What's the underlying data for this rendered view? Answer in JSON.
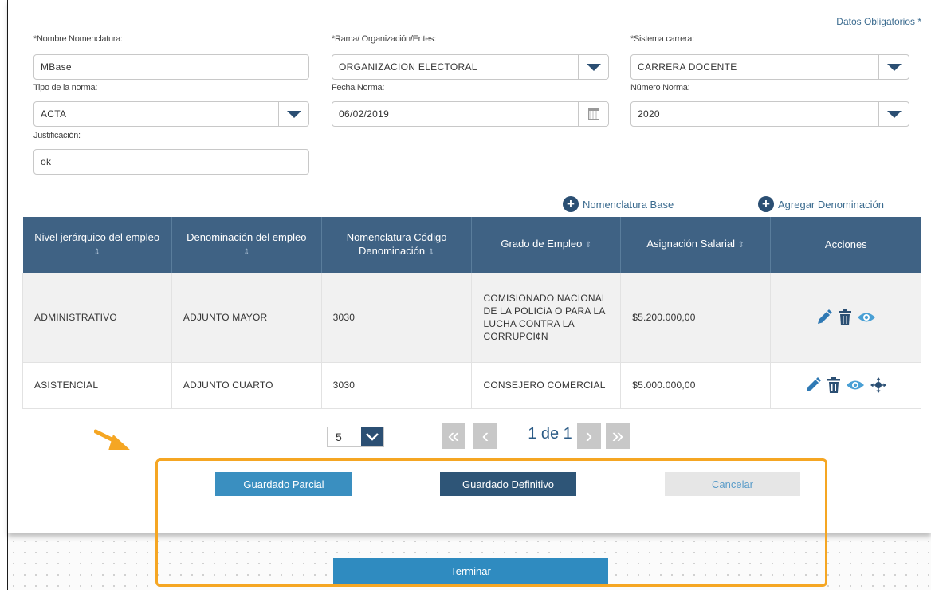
{
  "required_note": "Datos Obligatorios *",
  "fields": {
    "nombre_label": "*Nombre Nomenclatura:",
    "nombre_value": "MBase",
    "rama_label": "*Rama/ Organización/Entes:",
    "rama_value": "ORGANIZACION ELECTORAL",
    "sistema_label": "*Sistema carrera:",
    "sistema_value": "CARRERA DOCENTE",
    "tipo_label": "Tipo de la norma:",
    "tipo_value": "ACTA",
    "fecha_label": "Fecha Norma:",
    "fecha_value": "06/02/2019",
    "numero_label": "Número Norma:",
    "numero_value": "2020",
    "justificacion_label": "Justificación:",
    "justificacion_value": "ok"
  },
  "links": {
    "nomenclatura_base": "Nomenclatura Base",
    "agregar_denominacion": "Agregar Denominación"
  },
  "table": {
    "headers": [
      "Nivel jerárquico del empleo",
      "Denominación del empleo",
      "Nomenclatura Código Denominación",
      "Grado de Empleo",
      "Asignación Salarial",
      "Acciones"
    ],
    "rows": [
      {
        "nivel": "ADMINISTRATIVO",
        "denominacion": "ADJUNTO MAYOR",
        "codigo": "3030",
        "grado": "COMISIONADO NACIONAL DE LA POLICiA O PARA LA LUCHA CONTRA LA CORRUPCI¢N",
        "salario": "$5.200.000,00"
      },
      {
        "nivel": "ASISTENCIAL",
        "denominacion": "ADJUNTO CUARTO",
        "codigo": "3030",
        "grado": "CONSEJERO COMERCIAL",
        "salario": "$5.000.000,00"
      }
    ]
  },
  "pager": {
    "page_size": "5",
    "info": "1 de 1"
  },
  "buttons": {
    "guardado_parcial": "Guardado Parcial",
    "guardado_definitivo": "Guardado Definitivo",
    "cancelar": "Cancelar",
    "terminar": "Terminar"
  },
  "colors": {
    "header_bg": "#3f6284",
    "primary_light": "#3a8fc0",
    "primary_dark": "#2e5577",
    "highlight": "#f5a623",
    "arrow": "#f5a623"
  }
}
